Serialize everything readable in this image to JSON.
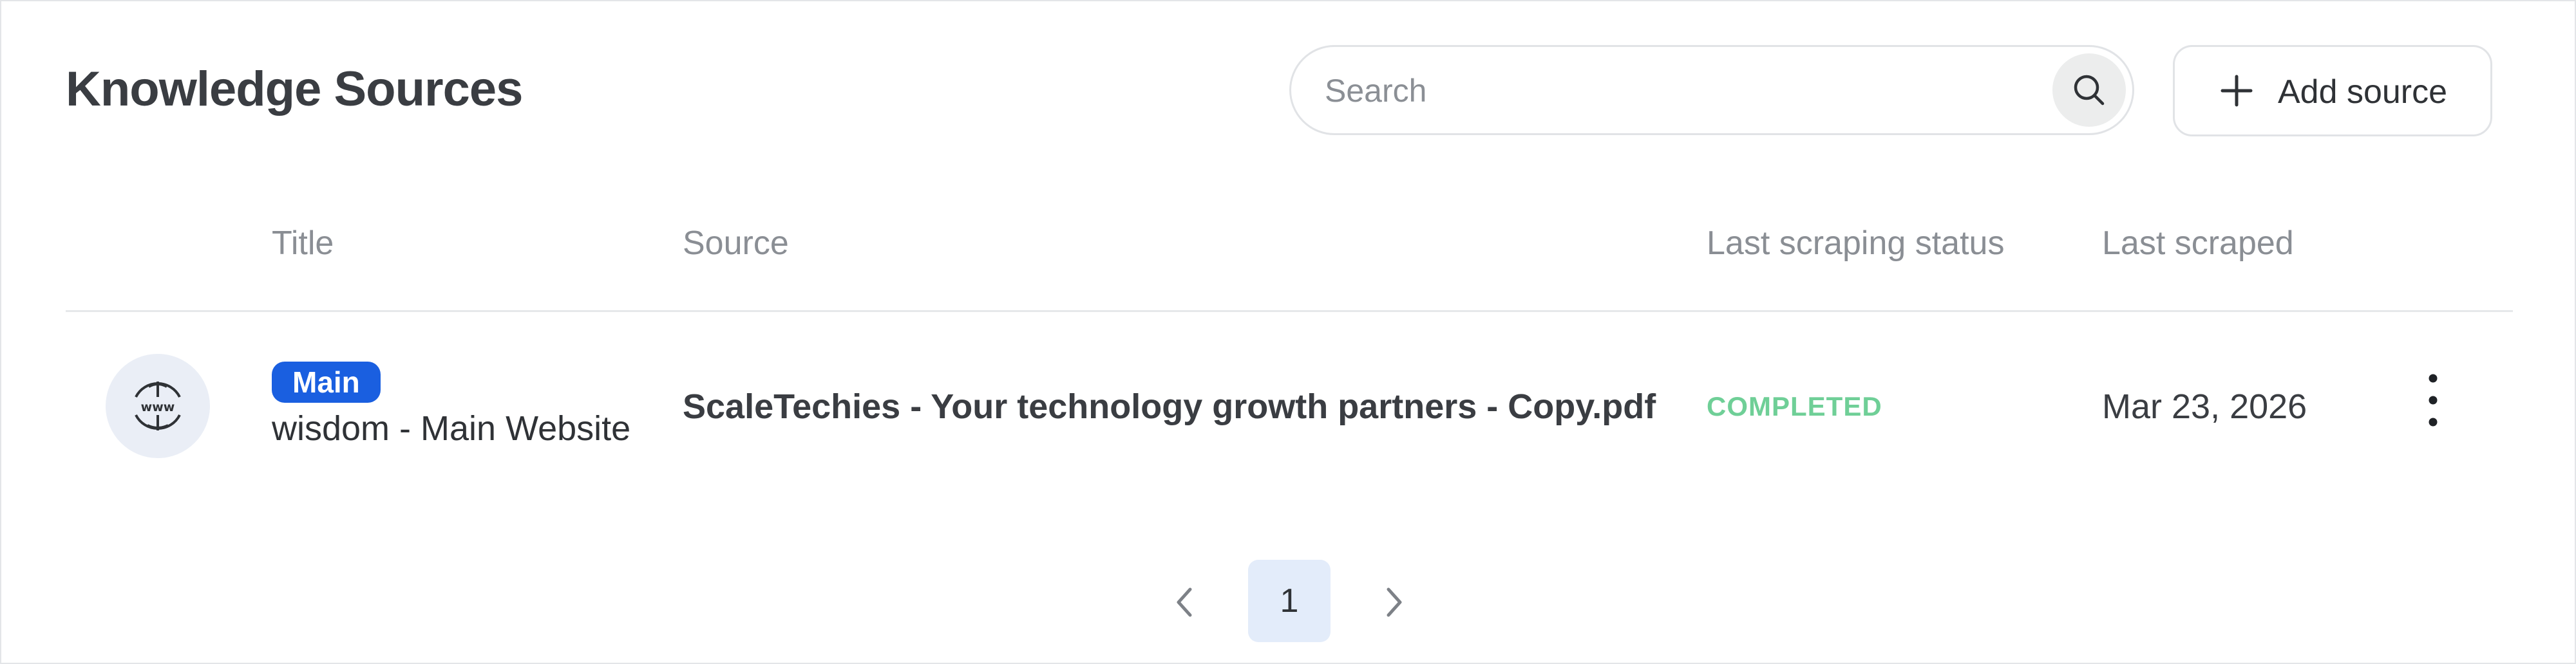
{
  "header": {
    "title": "Knowledge Sources",
    "search": {
      "placeholder": "Search",
      "value": "",
      "button_icon": "search-icon"
    },
    "add_button": {
      "label": "Add source",
      "icon": "plus-icon"
    }
  },
  "table": {
    "columns": [
      "Title",
      "Source",
      "Last scraping status",
      "Last scraped"
    ],
    "rows": [
      {
        "icon": "globe-www-icon",
        "badge": "Main",
        "title": "wisdom - Main Website",
        "source": "ScaleTechies - Your technology growth partners - Copy.pdf",
        "status": "COMPLETED",
        "last_scraped": "Mar 23, 2026",
        "menu_icon": "more-vertical-icon"
      }
    ]
  },
  "pagination": {
    "current_page": "1",
    "prev_icon": "chevron-left-icon",
    "next_icon": "chevron-right-icon"
  },
  "colors": {
    "badge": "#1a5fe0",
    "status_completed": "#6fcf97",
    "icon_bg": "#eaeef6",
    "active_page_bg": "#e3ecfa"
  }
}
